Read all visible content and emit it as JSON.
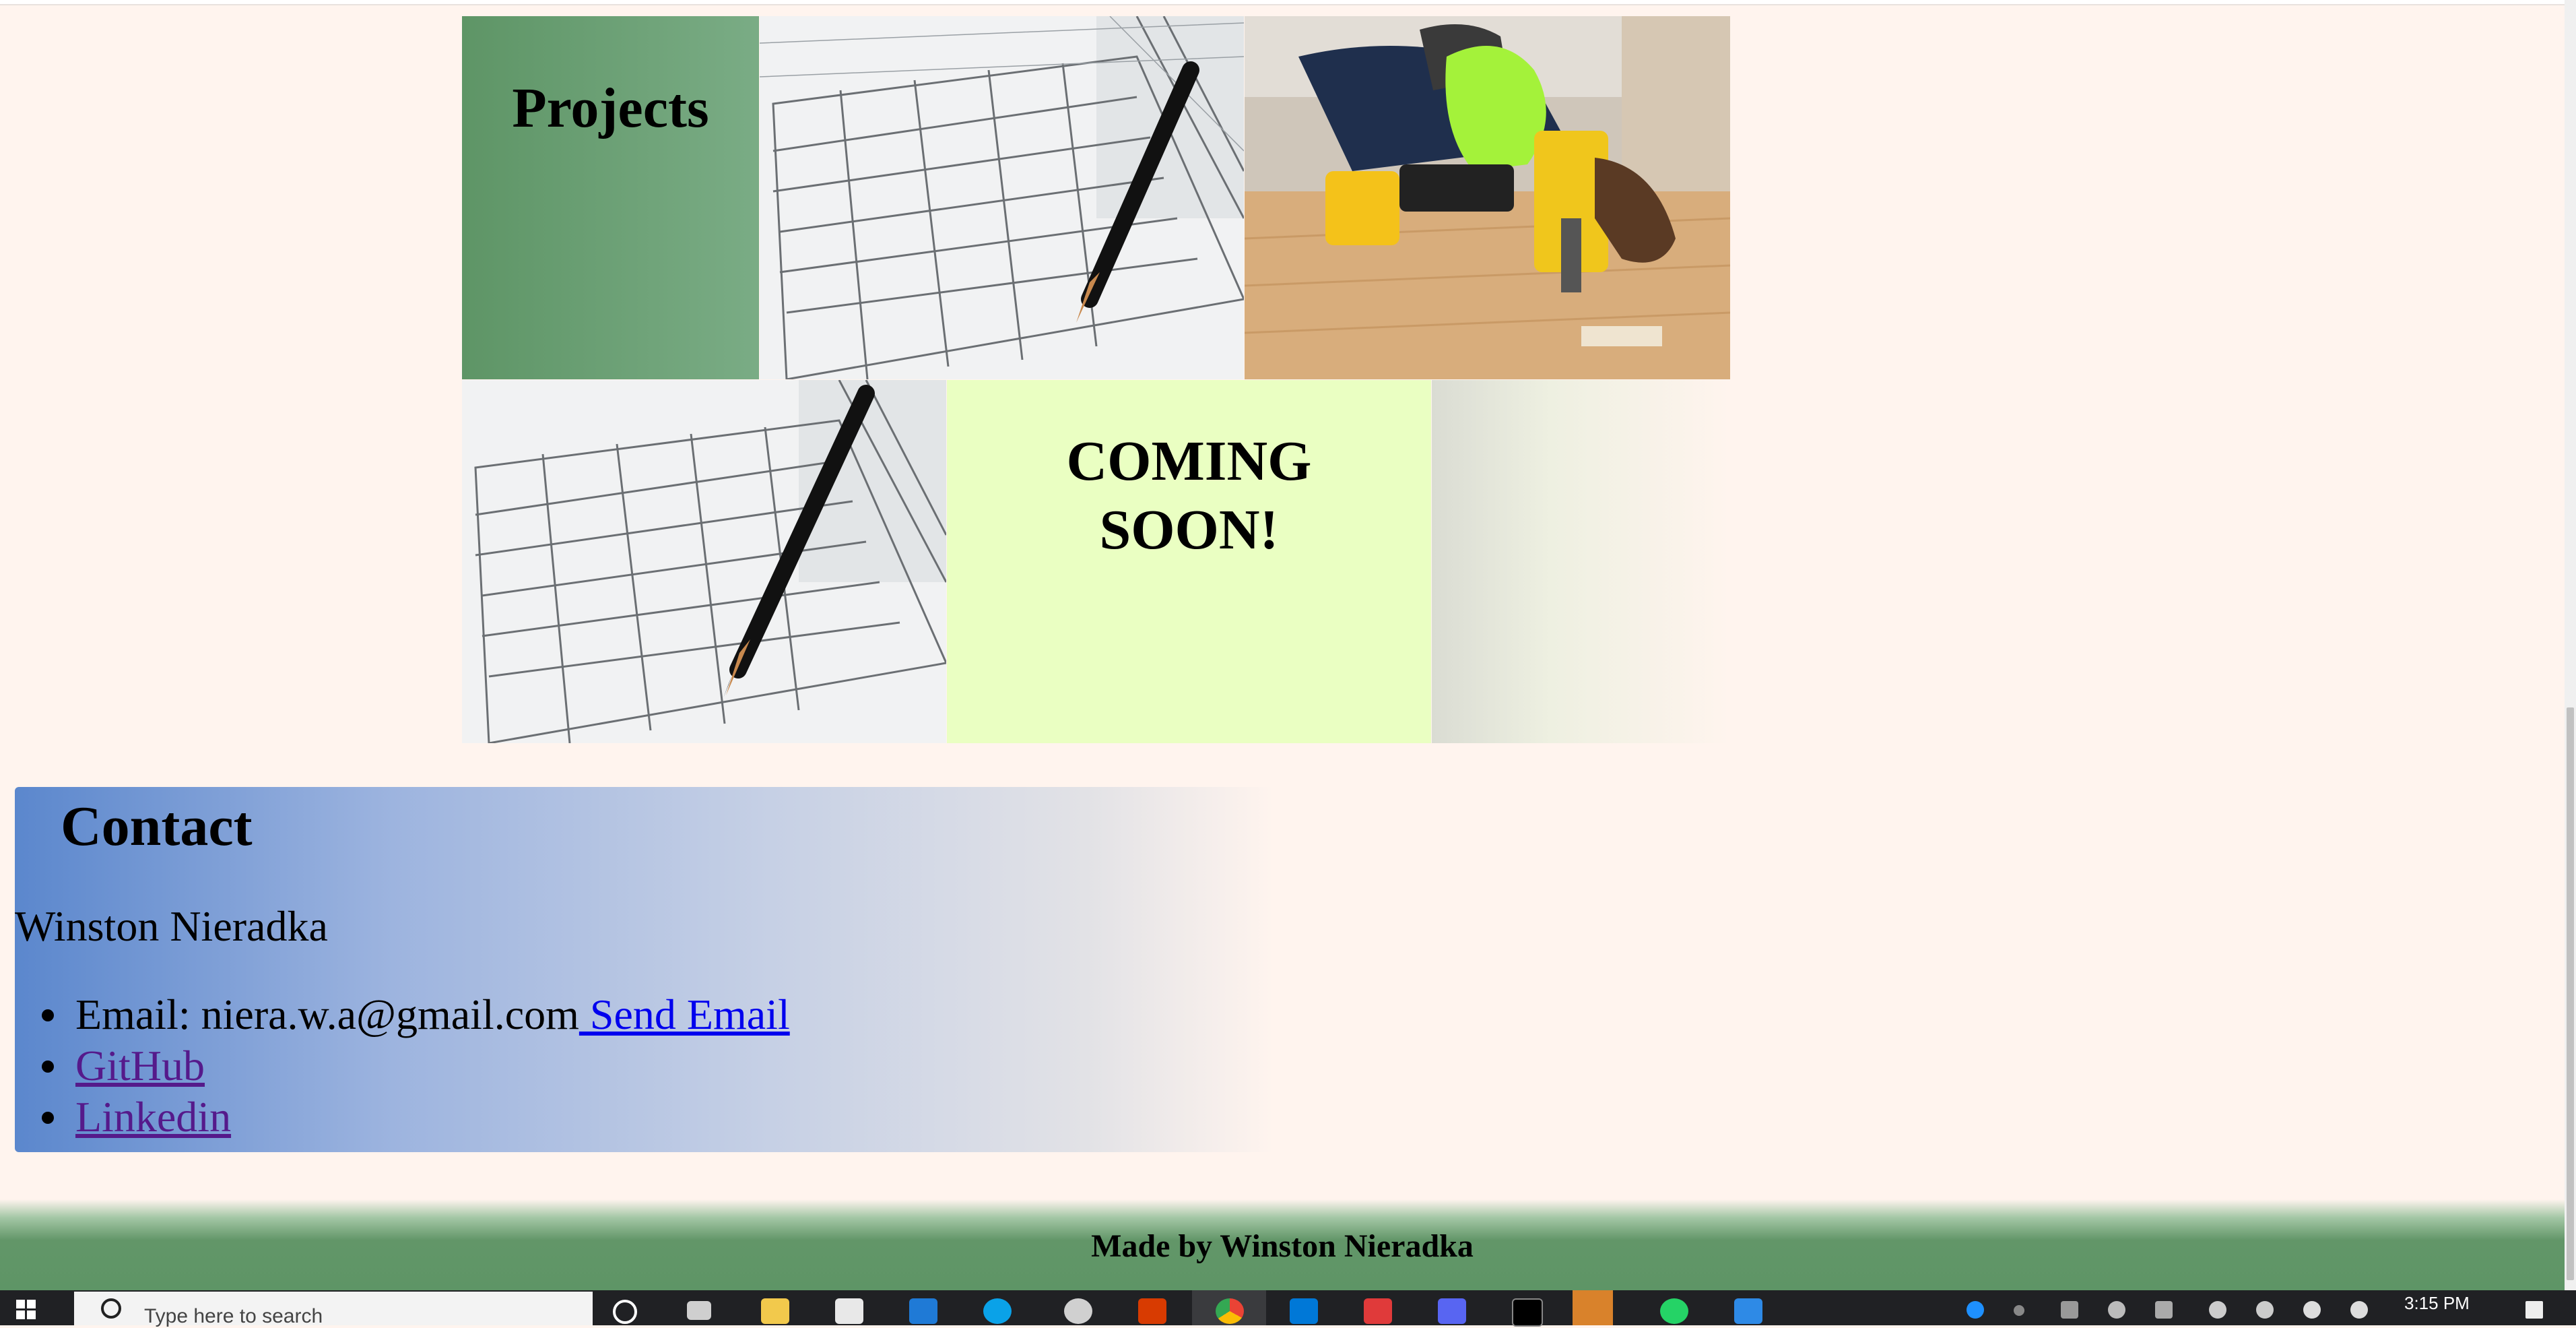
{
  "projects": {
    "heading": "Projects",
    "coming_soon": "COMING SOON!"
  },
  "contact": {
    "heading": "Contact",
    "name": "Winston Nieradka",
    "email_prefix": "Email: niera.w.a@gmail.com",
    "send_email_label": " Send Email",
    "github_label": "GitHub",
    "linkedin_label": "Linkedin"
  },
  "footer": {
    "text": "Made by Winston Nieradka"
  },
  "taskbar": {
    "search_placeholder": "Type here to search",
    "clock": "3:15 PM"
  }
}
